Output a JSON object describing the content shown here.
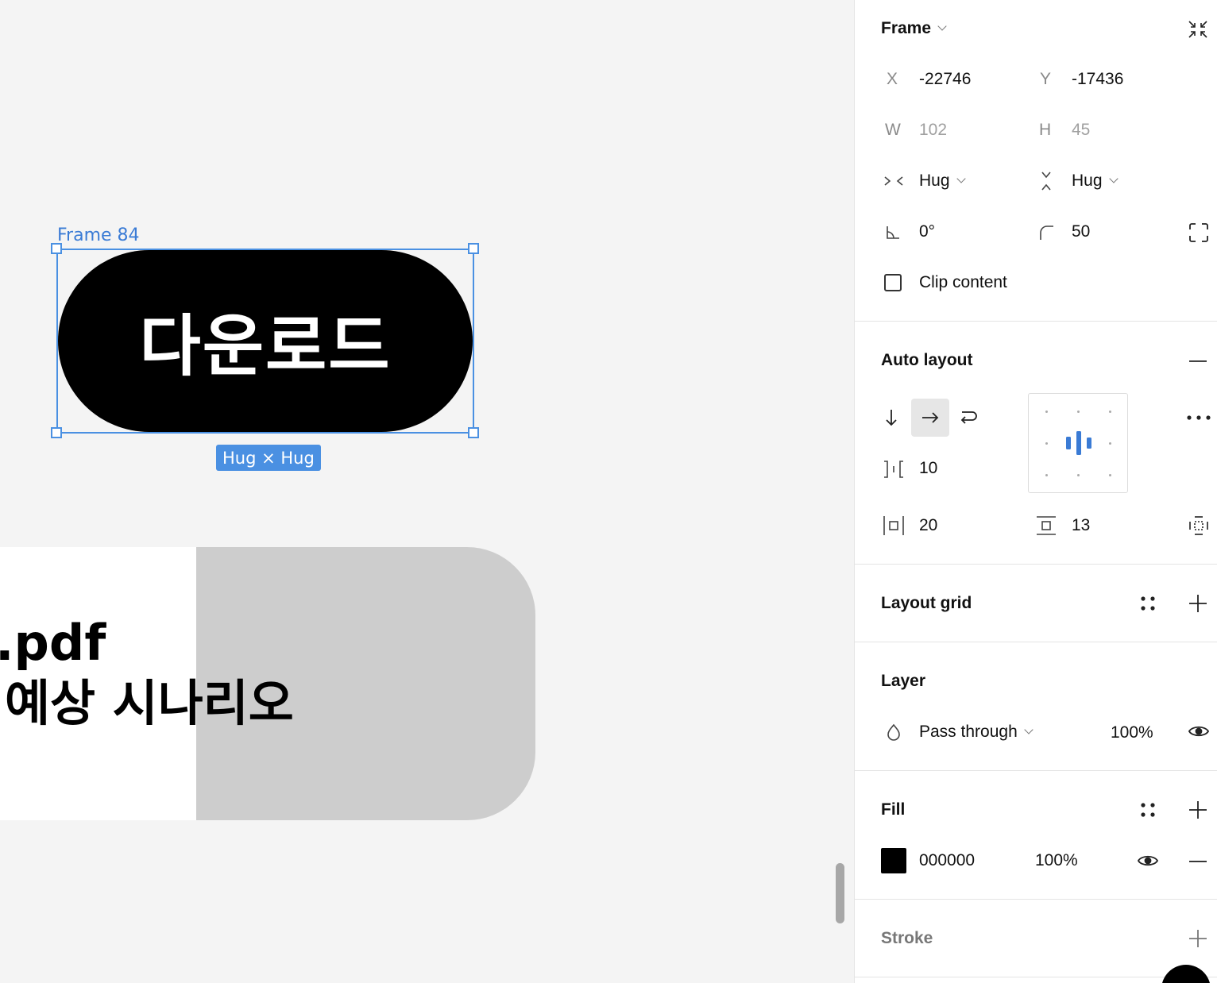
{
  "canvas": {
    "frame_label": "Frame 84",
    "button_text": "다운로드",
    "size_badge": "Hug × Hug",
    "card_line1": ".pdf",
    "card_line2": "예상 시나리오"
  },
  "panel": {
    "frame": {
      "title": "Frame"
    },
    "position": {
      "x_label": "X",
      "x_value": "-22746",
      "y_label": "Y",
      "y_value": "-17436"
    },
    "size": {
      "w_label": "W",
      "w_value": "102",
      "h_label": "H",
      "h_value": "45"
    },
    "resizing": {
      "horizontal": "Hug",
      "vertical": "Hug"
    },
    "rotation": "0°",
    "corner_radius": "50",
    "clip_content": "Clip content",
    "auto_layout": {
      "title": "Auto layout",
      "spacing": "10",
      "padding_horizontal": "20",
      "padding_vertical": "13"
    },
    "layout_grid": {
      "title": "Layout grid"
    },
    "layer": {
      "title": "Layer",
      "blend_mode": "Pass through",
      "opacity": "100%"
    },
    "fill": {
      "title": "Fill",
      "hex": "000000",
      "opacity": "100%",
      "color": "#000000"
    },
    "stroke": {
      "title": "Stroke"
    }
  },
  "colors": {
    "selection": "#4a90e2",
    "canvas_bg": "#f4f4f4",
    "accent_blue": "#3a7bd5"
  },
  "icons": [
    "collapse-icon",
    "horizontal-resize-icon",
    "vertical-resize-icon",
    "rotation-icon",
    "corner-radius-icon",
    "independent-corners-icon",
    "arrow-down-icon",
    "arrow-right-icon",
    "wrap-icon",
    "more-icon",
    "spacing-icon",
    "horizontal-padding-icon",
    "vertical-padding-icon",
    "individual-padding-icon",
    "styles-icon",
    "plus-icon",
    "minus-icon",
    "blend-icon",
    "eye-icon",
    "help-icon"
  ]
}
